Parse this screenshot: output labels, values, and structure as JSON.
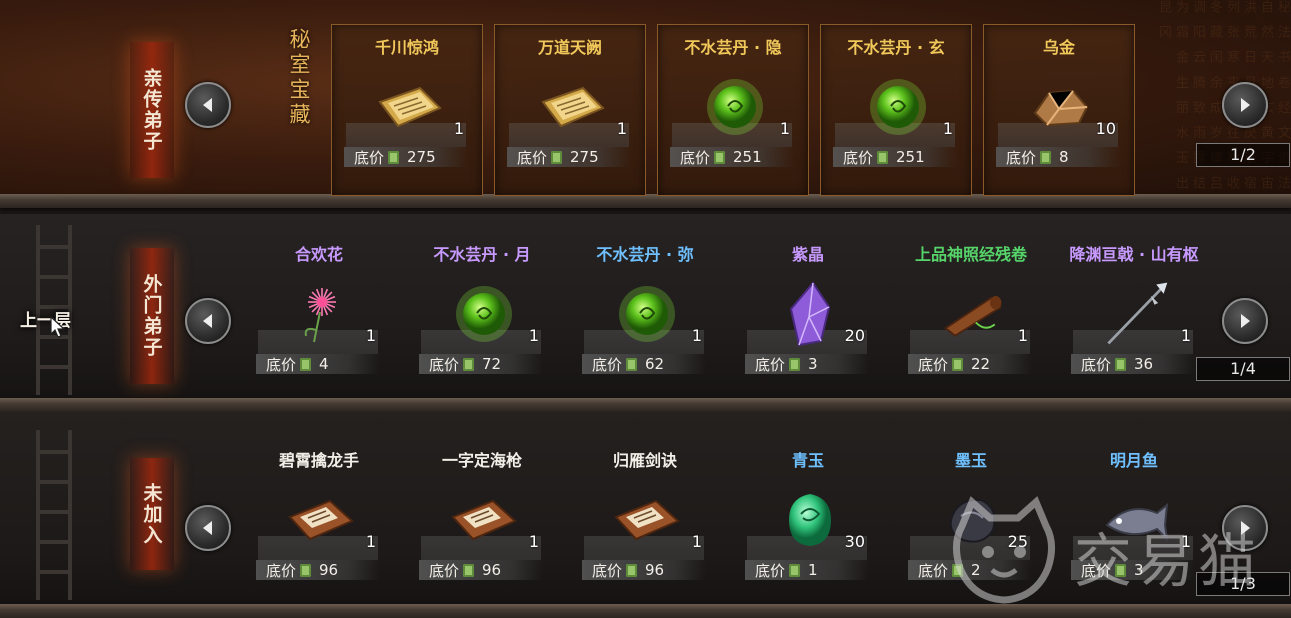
{
  "background_text": "秘 法 书 卷 经 文 道 法 自 然 天 地 玄 黄 宇 宙 洪 荒 日 月 盈 昃 辰 宿 列 张 寒 来 暑 往 秋 收 冬 藏 闰 余 成 岁 律 吕 调 阳 云 腾 致 雨 露 结 为 霜 金 生 丽 水 玉 出 昆 冈",
  "treasure_title": "秘室宝藏",
  "up_floor_label": "上一层",
  "rows": [
    {
      "category": "亲传弟子",
      "page": "1/2",
      "items": [
        {
          "name": "千川惊鸿",
          "name_color": "#f1c85a",
          "icon": "scroll-book-icon",
          "qty": "1",
          "price_label": "底价",
          "price": "275"
        },
        {
          "name": "万道天阙",
          "name_color": "#f1c85a",
          "icon": "scroll-book-icon",
          "qty": "1",
          "price_label": "底价",
          "price": "275"
        },
        {
          "name": "不水芸丹 · 隐",
          "name_color": "#f1c85a",
          "icon": "green-orb-icon",
          "qty": "1",
          "price_label": "底价",
          "price": "251"
        },
        {
          "name": "不水芸丹 · 玄",
          "name_color": "#f1c85a",
          "icon": "green-orb-icon",
          "qty": "1",
          "price_label": "底价",
          "price": "251"
        },
        {
          "name": "乌金",
          "name_color": "#f1c85a",
          "icon": "ore-icon",
          "qty": "10",
          "price_label": "底价",
          "price": "8"
        }
      ]
    },
    {
      "category": "外门弟子",
      "page": "1/4",
      "items": [
        {
          "name": "合欢花",
          "name_color": "#c89aff",
          "icon": "flower-icon",
          "qty": "1",
          "price_label": "底价",
          "price": "4"
        },
        {
          "name": "不水芸丹 · 月",
          "name_color": "#c89aff",
          "icon": "green-orb-icon",
          "qty": "1",
          "price_label": "底价",
          "price": "72"
        },
        {
          "name": "不水芸丹 · 弥",
          "name_color": "#6fc0ff",
          "icon": "green-orb-icon",
          "qty": "1",
          "price_label": "底价",
          "price": "62"
        },
        {
          "name": "紫晶",
          "name_color": "#c89aff",
          "icon": "crystal-icon",
          "qty": "20",
          "price_label": "底价",
          "price": "3"
        },
        {
          "name": "上品神照经残卷",
          "name_color": "#56d46a",
          "icon": "scroll-roll-icon",
          "qty": "1",
          "price_label": "底价",
          "price": "22"
        },
        {
          "name": "降渊亘戟 · 山有枢",
          "name_color": "#c89aff",
          "icon": "halberd-icon",
          "qty": "1",
          "price_label": "底价",
          "price": "36"
        }
      ]
    },
    {
      "category": "未加入",
      "page": "1/3",
      "items": [
        {
          "name": "碧霄擒龙手",
          "name_color": "#f3efe8",
          "icon": "manual-book-icon",
          "qty": "1",
          "price_label": "底价",
          "price": "96"
        },
        {
          "name": "一字定海枪",
          "name_color": "#f3efe8",
          "icon": "manual-book-icon",
          "qty": "1",
          "price_label": "底价",
          "price": "96"
        },
        {
          "name": "归雁剑诀",
          "name_color": "#f3efe8",
          "icon": "manual-book-icon",
          "qty": "1",
          "price_label": "底价",
          "price": "96"
        },
        {
          "name": "青玉",
          "name_color": "#6fc0ff",
          "icon": "jade-icon",
          "qty": "30",
          "price_label": "底价",
          "price": "1"
        },
        {
          "name": "墨玉",
          "name_color": "#6fc0ff",
          "icon": "dark-jade-icon",
          "qty": "25",
          "price_label": "底价",
          "price": "2"
        },
        {
          "name": "明月鱼",
          "name_color": "#6fc0ff",
          "icon": "fish-icon",
          "qty": "1",
          "price_label": "底价",
          "price": "3"
        }
      ]
    }
  ],
  "watermark_text": "交易猫"
}
